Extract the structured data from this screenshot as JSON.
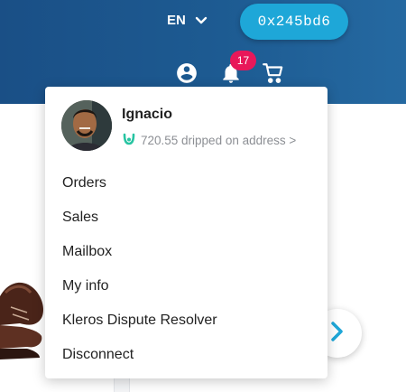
{
  "header": {
    "language": "EN",
    "wallet_address": "0x245bd6",
    "notification_count": "17",
    "icons": [
      "account-circle-icon",
      "bell-icon",
      "cart-icon",
      "chevron-down-icon"
    ]
  },
  "user_menu": {
    "name": "Ignacio",
    "drip_text": "720.55 dripped on address >",
    "items": [
      {
        "label": "Orders"
      },
      {
        "label": "Sales"
      },
      {
        "label": "Mailbox"
      },
      {
        "label": "My info"
      },
      {
        "label": "Kleros Dispute Resolver"
      },
      {
        "label": "Disconnect"
      }
    ]
  },
  "colors": {
    "header": "#1d5b92",
    "accent": "#1ea7d8",
    "badge": "#e8185a",
    "drip_icon": "#27c4a2"
  }
}
